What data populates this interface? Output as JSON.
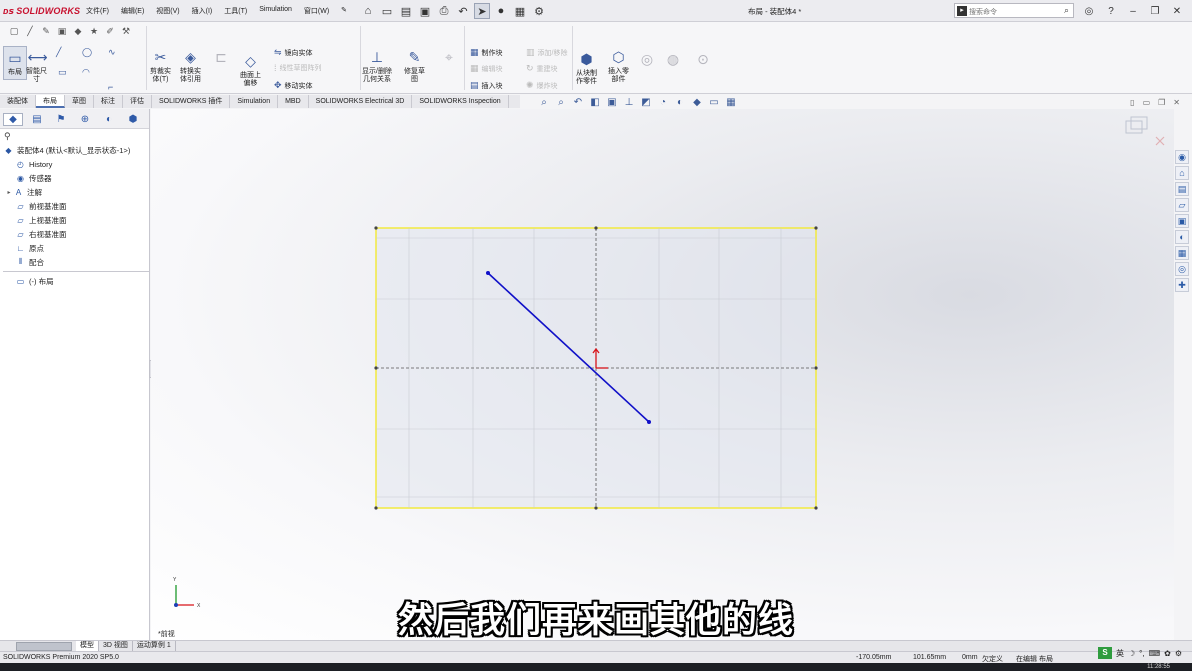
{
  "titlebar": {
    "logo_text": "SOLIDWORKS",
    "menu": [
      "文件(F)",
      "编辑(E)",
      "视图(V)",
      "插入(I)",
      "工具(T)",
      "Simulation",
      "窗口(W)"
    ],
    "doc_title": "布局 - 装配体4 *",
    "search_placeholder": "搜索命令"
  },
  "ribbon": {
    "layout_btn": "布局",
    "smart_dim": "智能尺\n寸",
    "trim": "剪裁实\n体(T)",
    "convert": "转换实\n体引用",
    "offset_surface": "曲面上\n偏移",
    "mirror": "镜向实体",
    "linear_pattern": "线性草图阵列",
    "move": "移动实体",
    "display_relations": "显示/删除\n几何关系",
    "repair": "修复草\n图",
    "make_block": "制作块",
    "edit_block": "编辑块",
    "insert_block": "插入块",
    "add_remove": "添加/移除",
    "rebuild": "重建块",
    "explode_block": "爆炸块",
    "from_block": "从块制\n作零件",
    "insert_part": "插入零\n部件"
  },
  "tabs": [
    "装配体",
    "布局",
    "草图",
    "标注",
    "评估",
    "SOLIDWORKS 插件",
    "Simulation",
    "MBD",
    "SOLIDWORKS Electrical 3D",
    "SOLIDWORKS Inspection"
  ],
  "tree": {
    "root": "装配体4 (默认<默认_显示状态-1>)",
    "items": [
      "History",
      "传感器",
      "注解",
      "前视基准面",
      "上视基准面",
      "右视基准面",
      "原点",
      "配合"
    ],
    "layout": "(-) 布局"
  },
  "viewport": {
    "view_label": "*前视"
  },
  "bottom_tabs": [
    "模型",
    "3D 视图",
    "运动算例 1"
  ],
  "statusbar": {
    "product": "SOLIDWORKS Premium 2020 SP5.0",
    "x": "-170.05mm",
    "y": "101.65mm",
    "z": "0mm",
    "state": "欠定义",
    "editing": "在编辑 布局"
  },
  "ime": {
    "lang": "英"
  },
  "clock": "11:28:55",
  "subtitle": "然后我们再来画其他的线",
  "colors": {
    "sketch_line": "#1010c8",
    "boundary": "#f2ea3e",
    "origin": "#d8141a"
  }
}
